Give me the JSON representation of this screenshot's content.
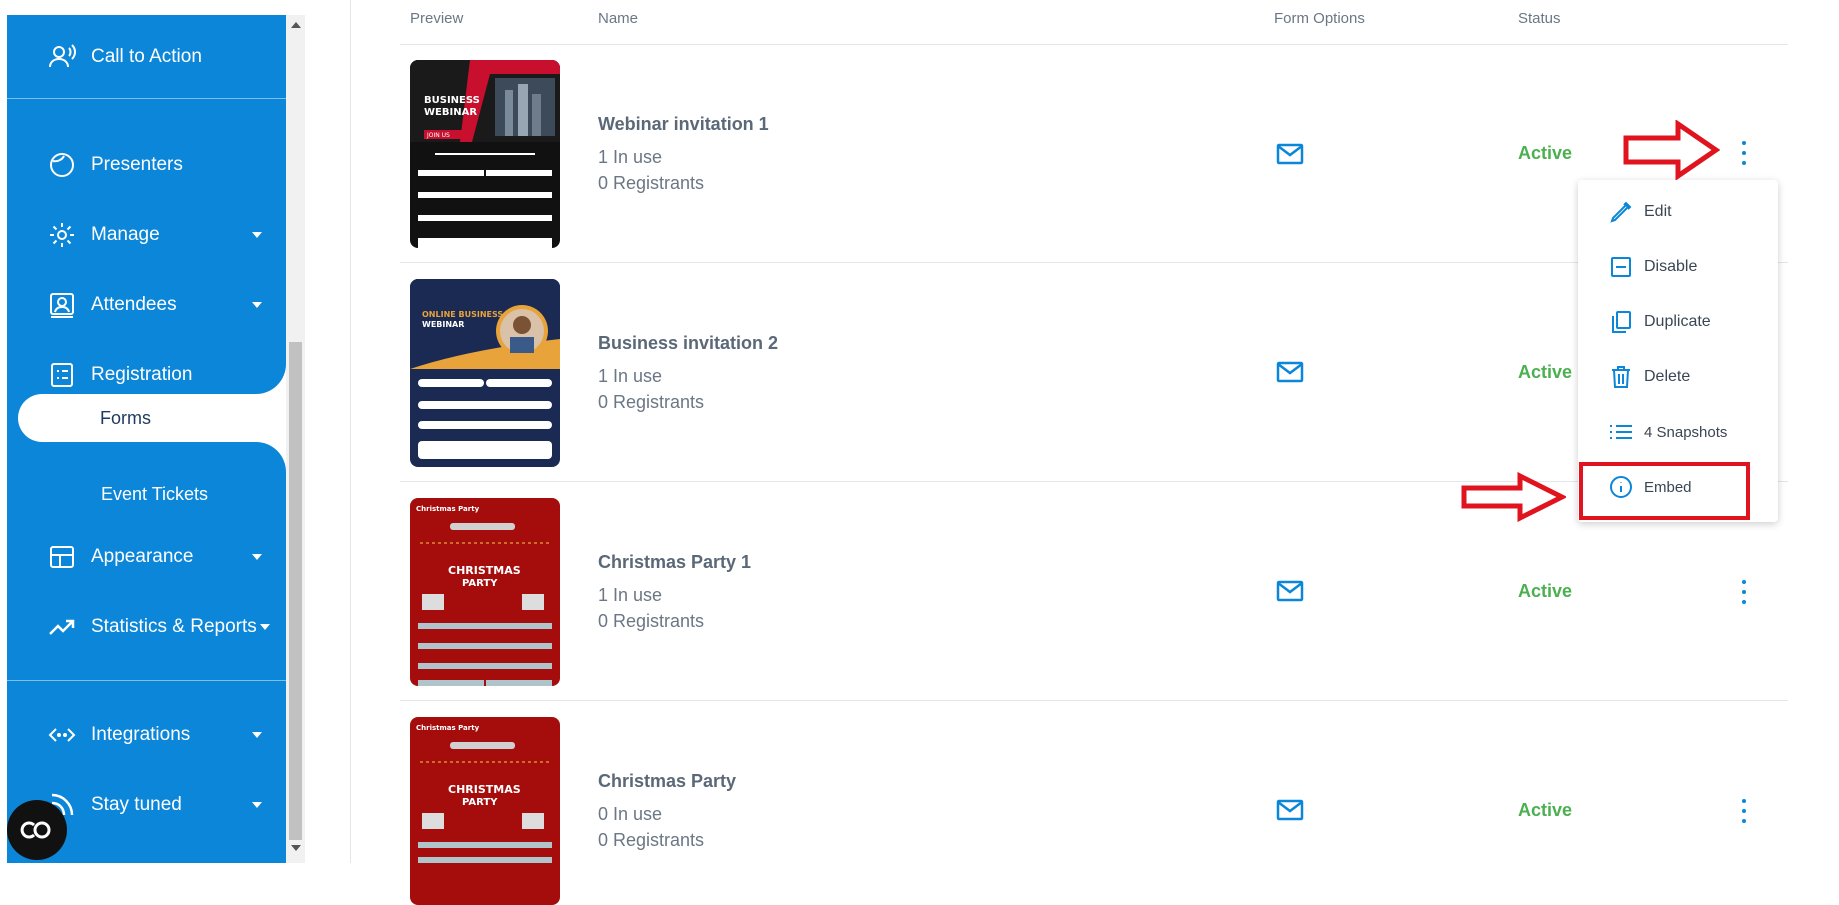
{
  "sidebar": {
    "items": [
      {
        "label": "Call to Action",
        "icon": "call-to-action-icon",
        "caret": false
      },
      {
        "label": "Presenters",
        "icon": "presenters-icon",
        "caret": false
      },
      {
        "label": "Manage",
        "icon": "gear-icon",
        "caret": true
      },
      {
        "label": "Attendees",
        "icon": "attendees-icon",
        "caret": true
      },
      {
        "label": "Registration",
        "icon": "registration-icon",
        "caret": true
      },
      {
        "label": "Appearance",
        "icon": "appearance-icon",
        "caret": true
      },
      {
        "label": "Statistics & Reports",
        "icon": "trending-up-icon",
        "caret": true
      },
      {
        "label": "Integrations",
        "icon": "integrations-icon",
        "caret": true
      },
      {
        "label": "Stay tuned",
        "icon": "stay-tuned-icon",
        "caret": true
      }
    ],
    "sub_items": {
      "forms": "Forms",
      "event_tickets": "Event Tickets"
    },
    "accent": "#0b86d9"
  },
  "table": {
    "headers": {
      "preview": "Preview",
      "name": "Name",
      "form_options": "Form Options",
      "status": "Status"
    },
    "rows": [
      {
        "name": "Webinar invitation 1",
        "in_use": "1 In use",
        "registrants": "0 Registrants",
        "status": "Active",
        "preview": "business-webinar-dark"
      },
      {
        "name": "Business invitation 2",
        "in_use": "1 In use",
        "registrants": "0 Registrants",
        "status": "Active",
        "preview": "online-business-webinar-navy"
      },
      {
        "name": "Christmas Party 1",
        "in_use": "1 In use",
        "registrants": "0 Registrants",
        "status": "Active",
        "preview": "christmas-party-red"
      },
      {
        "name": "Christmas Party",
        "in_use": "0 In use",
        "registrants": "0 Registrants",
        "status": "Active",
        "preview": "christmas-party-red"
      }
    ]
  },
  "thumbnails": {
    "business": {
      "title": "BUSINESS WEBINAR",
      "cta": "JOIN US"
    },
    "online": {
      "title": "ONLINE BUSINESS WEBINAR"
    },
    "christmas": {
      "header": "Christmas Party",
      "title": "CHRISTMAS PARTY"
    }
  },
  "menu": {
    "items": [
      {
        "label": "Edit",
        "icon": "pencil-icon"
      },
      {
        "label": "Disable",
        "icon": "disable-icon"
      },
      {
        "label": "Duplicate",
        "icon": "duplicate-icon"
      },
      {
        "label": "Delete",
        "icon": "trash-icon"
      },
      {
        "label": "4 Snapshots",
        "icon": "list-icon"
      },
      {
        "label": "Embed",
        "icon": "info-icon"
      }
    ]
  },
  "colors": {
    "status_active": "#4caf50",
    "annotation": "#e0141e"
  }
}
